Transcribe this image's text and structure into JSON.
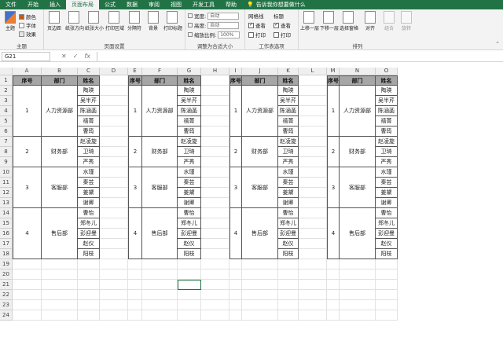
{
  "ribbon": {
    "tabs": [
      "文件",
      "开始",
      "插入",
      "页面布局",
      "公式",
      "数据",
      "审阅",
      "视图",
      "开发工具",
      "帮助"
    ],
    "active_tab": "页面布局",
    "tell_me": "告诉我你想要做什么",
    "theme": {
      "btn": "主题",
      "colors": "颜色",
      "fonts": "字体",
      "effects": "效果",
      "label": "主题"
    },
    "page_setup": {
      "buttons": [
        "页边距",
        "纸张方向",
        "纸张大小",
        "打印区域",
        "分隔符",
        "背景",
        "打印标题"
      ],
      "label": "页面设置"
    },
    "scale": {
      "width_label": "宽度:",
      "width_value": "自动",
      "height_label": "高度:",
      "height_value": "自动",
      "scale_label": "缩放比例:",
      "scale_value": "100%",
      "label": "调整为合适大小"
    },
    "sheet_options": {
      "gridlines": "网格线",
      "headings": "标题",
      "view": "查看",
      "print": "打印",
      "label": "工作表选项"
    },
    "arrange": {
      "buttons": [
        "上移一层",
        "下移一层",
        "选择窗格",
        "对齐",
        "组合",
        "旋转"
      ],
      "label": "排列"
    }
  },
  "formula_bar": {
    "name_box": "G21",
    "cancel": "✕",
    "enter": "✓",
    "fx": "fx",
    "value": ""
  },
  "columns": [
    "A",
    "B",
    "C",
    "D",
    "E",
    "F",
    "G",
    "H",
    "I",
    "J",
    "K",
    "L",
    "M",
    "N",
    "O"
  ],
  "rows": [
    "1",
    "2",
    "3",
    "4",
    "5",
    "6",
    "7",
    "8",
    "9",
    "10",
    "11",
    "12",
    "13",
    "14",
    "15",
    "16",
    "17",
    "18",
    "19",
    "20",
    "21",
    "22",
    "23",
    "24"
  ],
  "table": {
    "headers": [
      "序号",
      "部门",
      "姓名"
    ],
    "groups": [
      {
        "no": "1",
        "dept": "人力资源部",
        "names": [
          "陶瑛",
          "吴半芹",
          "陈涵菡",
          "禧菁",
          "曹筠"
        ]
      },
      {
        "no": "2",
        "dept": "财务部",
        "names": [
          "赵凌旋",
          "卫琦",
          "严秀"
        ]
      },
      {
        "no": "3",
        "dept": "客服部",
        "names": [
          "水瑾",
          "秦芸",
          "姜黛",
          "谢卿"
        ]
      },
      {
        "no": "4",
        "dept": "售后部",
        "names": [
          "曹怡",
          "郑冬儿",
          "彭迎曼",
          "赵仪",
          "阳枝"
        ]
      }
    ]
  }
}
